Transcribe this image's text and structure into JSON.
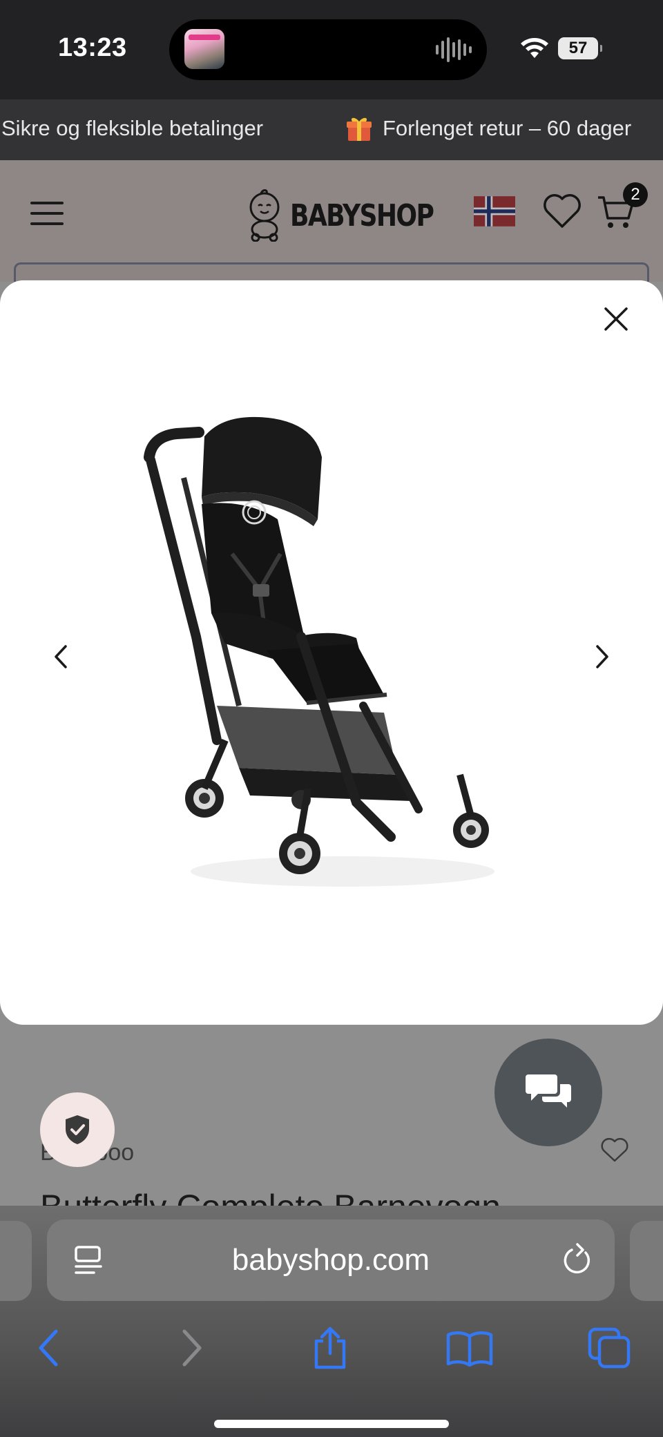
{
  "status_bar": {
    "time": "13:23",
    "battery": "57"
  },
  "promo": {
    "left_text": "Sikre og fleksible betalinger",
    "right_text": "Forlenget retur – 60 dager"
  },
  "header": {
    "logo_text": "BABYSHOP",
    "cart_count": "2"
  },
  "modal": {
    "product_image_alt": "Bugaboo Butterfly barnevogn"
  },
  "product": {
    "brand": "Bugaboo",
    "title": "Butterfly Complete Barnevogn"
  },
  "safari": {
    "url": "babyshop.com"
  },
  "colors": {
    "accent_blue": "#3478f6",
    "chat_fab": "#4e5458",
    "trust_badge": "#f4e6e4"
  }
}
